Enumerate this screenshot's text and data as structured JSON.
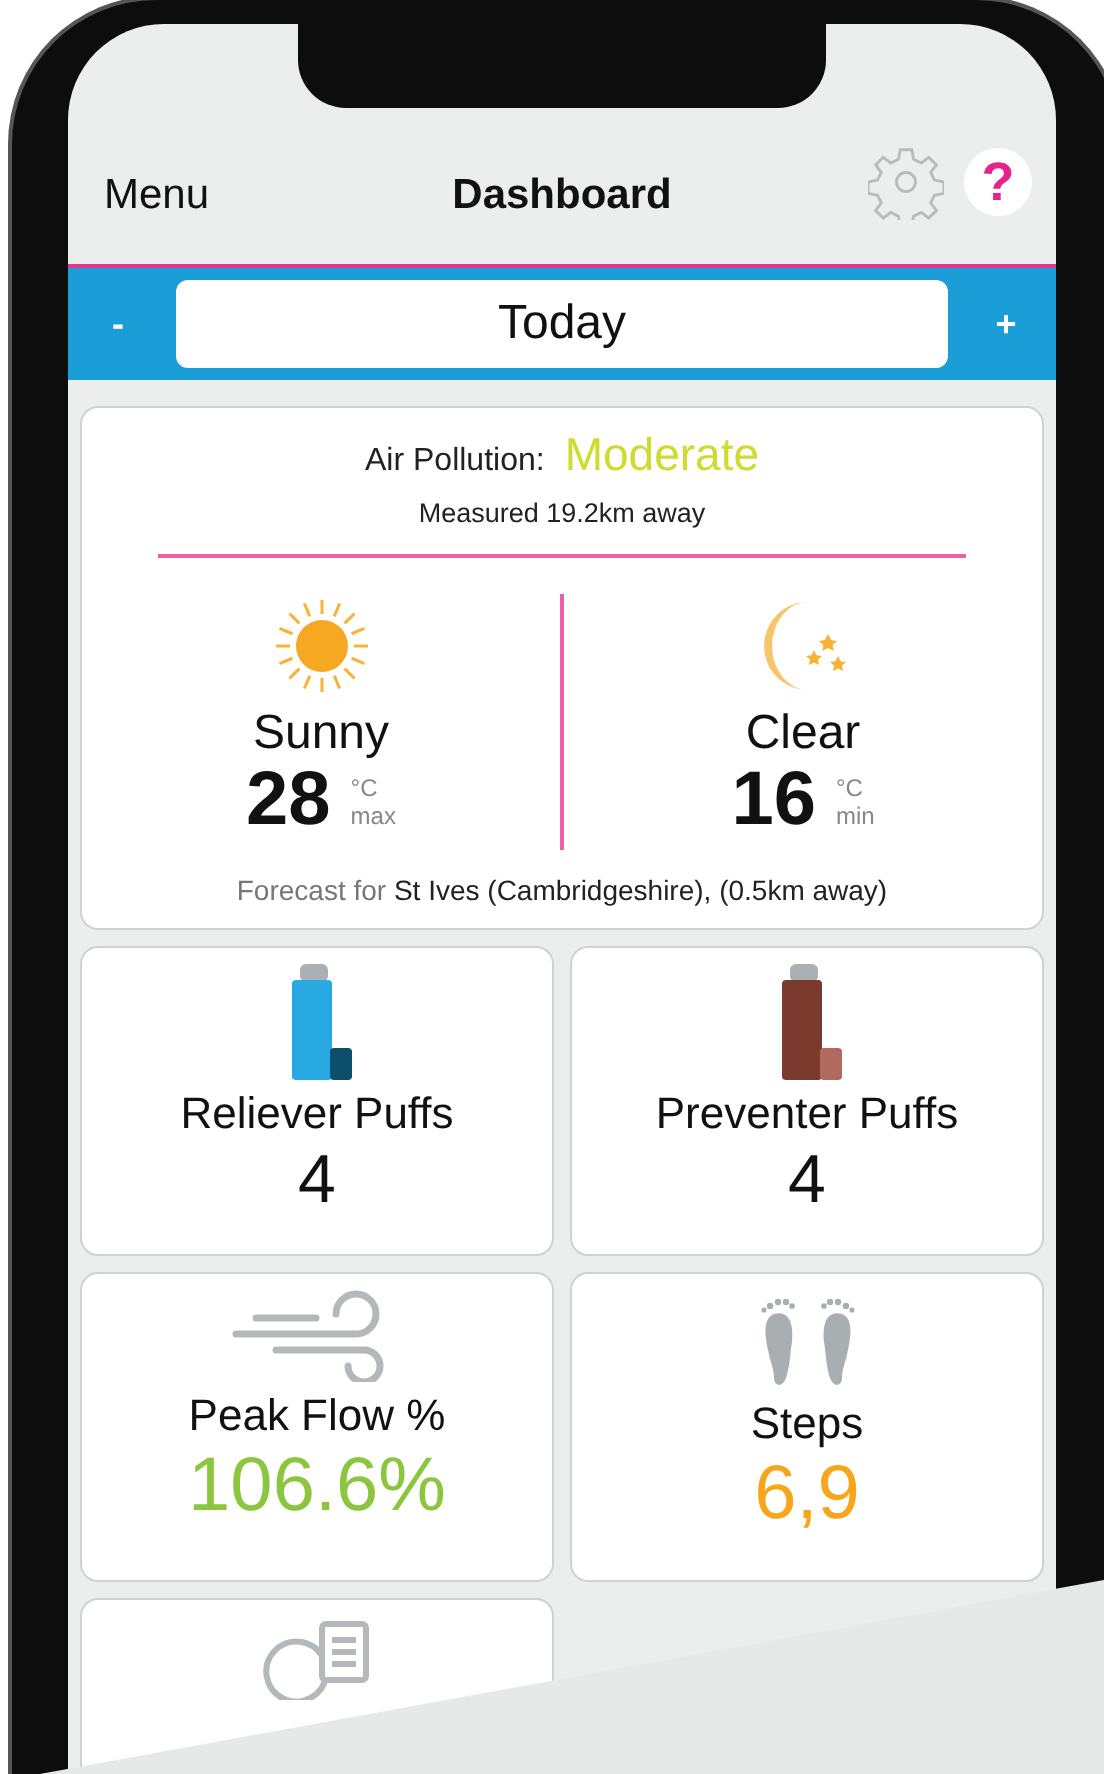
{
  "header": {
    "menu": "Menu",
    "title": "Dashboard",
    "help": "?"
  },
  "date_bar": {
    "prev": "-",
    "date": "Today",
    "next": "+"
  },
  "air_pollution": {
    "label": "Air Pollution:",
    "level": "Moderate",
    "measured": "Measured 19.2km away"
  },
  "weather": [
    {
      "kind": "sun",
      "condition": "Sunny",
      "temp": "28",
      "unit": "°C",
      "qualifier": "max"
    },
    {
      "kind": "moon",
      "condition": "Clear",
      "temp": "16",
      "unit": "°C",
      "qualifier": "min"
    }
  ],
  "forecast": {
    "prefix": "Forecast for",
    "place": "St Ives (Cambridgeshire), (0.5km away)"
  },
  "tiles": [
    {
      "kind": "reliever",
      "label": "Reliever Puffs",
      "value": "4"
    },
    {
      "kind": "preventer",
      "label": "Preventer Puffs",
      "value": "4"
    },
    {
      "kind": "peak_flow",
      "label": "Peak Flow %",
      "value": "106.6%"
    },
    {
      "kind": "steps",
      "label": "Steps",
      "value": "6,9"
    },
    {
      "kind": "diary"
    }
  ]
}
